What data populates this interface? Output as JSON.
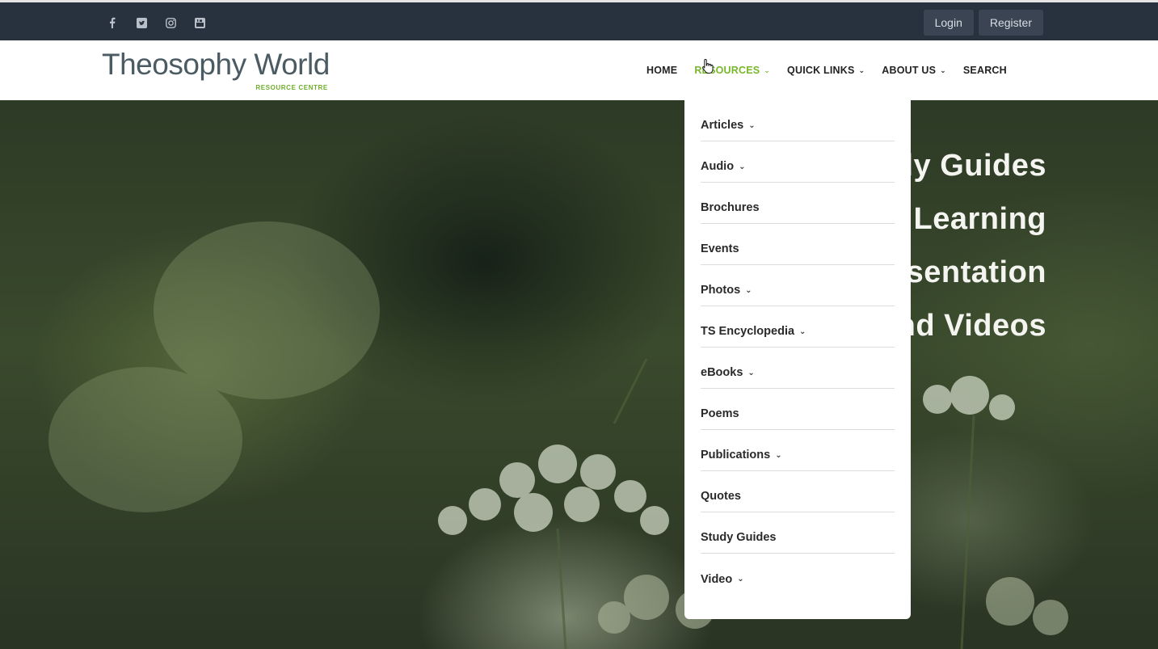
{
  "topbar": {
    "social": [
      {
        "icon": "facebook-icon",
        "glyph": "f"
      },
      {
        "icon": "twitter-square-icon",
        "glyph": "t"
      },
      {
        "icon": "instagram-icon",
        "glyph": "i"
      },
      {
        "icon": "youtube-icon",
        "glyph": "y"
      }
    ],
    "login_label": "Login",
    "register_label": "Register"
  },
  "brand": {
    "name": "Theosophy World",
    "tagline": "RESOURCE CENTRE",
    "accent_color": "#6fae2a"
  },
  "nav": {
    "items": [
      {
        "label": "HOME",
        "has_dropdown": false
      },
      {
        "label": "RESOURCES",
        "has_dropdown": true,
        "active": true
      },
      {
        "label": "QUICK LINKS",
        "has_dropdown": true
      },
      {
        "label": "ABOUT US",
        "has_dropdown": true
      },
      {
        "label": "SEARCH",
        "has_dropdown": false
      }
    ]
  },
  "resources_menu": {
    "items": [
      {
        "label": "Articles",
        "has_submenu": true
      },
      {
        "label": "Audio",
        "has_submenu": true
      },
      {
        "label": "Brochures",
        "has_submenu": false
      },
      {
        "label": "Events",
        "has_submenu": false
      },
      {
        "label": "Photos",
        "has_submenu": true
      },
      {
        "label": "TS Encyclopedia",
        "has_submenu": true
      },
      {
        "label": "eBooks",
        "has_submenu": true
      },
      {
        "label": "Poems",
        "has_submenu": false
      },
      {
        "label": "Publications",
        "has_submenu": true
      },
      {
        "label": "Quotes",
        "has_submenu": false
      },
      {
        "label": "Study Guides",
        "has_submenu": false
      },
      {
        "label": "Video",
        "has_submenu": true
      }
    ]
  },
  "hero": {
    "lines": [
      "Study Guides",
      "Online Learning",
      "Presentation",
      "Audio and Videos"
    ]
  }
}
